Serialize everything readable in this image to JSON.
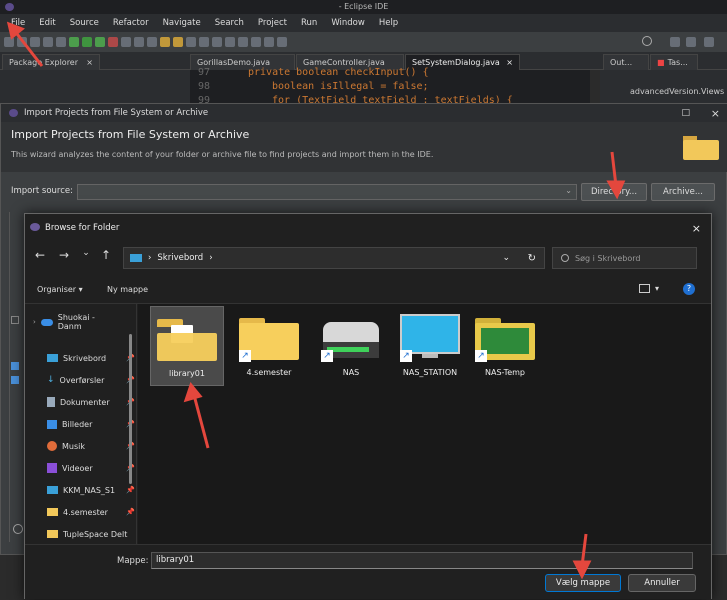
{
  "window": {
    "title": "- Eclipse IDE"
  },
  "menu": [
    "File",
    "Edit",
    "Source",
    "Refactor",
    "Navigate",
    "Search",
    "Project",
    "Run",
    "Window",
    "Help"
  ],
  "tabs": {
    "package_explorer": "Package Explorer",
    "editor_tabs": [
      "GorillasDemo.java",
      "GameController.java",
      "SetSystemDialog.java"
    ],
    "outline": "Out...",
    "tasks": "Tas..."
  },
  "code": {
    "lines": [
      {
        "n": "97",
        "t": "private boolean checkInput() {"
      },
      {
        "n": "98",
        "t": "boolean isIllegal = false;"
      },
      {
        "n": "99",
        "t": "for (TextField textField : textFields) {"
      }
    ],
    "right_panel_text": "advancedVersion.Views"
  },
  "import_dialog": {
    "window_title": "Import Projects from File System or Archive",
    "heading": "Import Projects from File System or Archive",
    "description": "This wizard analyzes the content of your folder or archive file to find projects and import them in the IDE.",
    "source_label": "Import source:",
    "directory_button": "Directory...",
    "archive_button": "Archive..."
  },
  "browse_dialog": {
    "title": "Browse for Folder",
    "address": "Skrivebord",
    "search_placeholder": "Søg i Skrivebord",
    "organize": "Organiser",
    "new_folder": "Ny mappe",
    "sidebar": [
      {
        "label": "Shuokai - Danm",
        "icon": "cloud-icon"
      },
      {
        "label": "Skrivebord",
        "icon": "desktop-icon"
      },
      {
        "label": "Overførsler",
        "icon": "download-icon"
      },
      {
        "label": "Dokumenter",
        "icon": "document-icon"
      },
      {
        "label": "Billeder",
        "icon": "picture-icon"
      },
      {
        "label": "Musik",
        "icon": "music-icon"
      },
      {
        "label": "Videoer",
        "icon": "video-icon"
      },
      {
        "label": "KKM_NAS_S1",
        "icon": "drive-icon"
      },
      {
        "label": "4.semester",
        "icon": "folder-icon"
      },
      {
        "label": "TupleSpace Delt",
        "icon": "folder-icon"
      }
    ],
    "items": [
      {
        "label": "library01",
        "kind": "folder",
        "selected": true
      },
      {
        "label": "4.semester",
        "kind": "folder-shortcut"
      },
      {
        "label": "NAS",
        "kind": "drive-shortcut"
      },
      {
        "label": "NAS_STATION",
        "kind": "monitor-shortcut"
      },
      {
        "label": "NAS-Temp",
        "kind": "folder-shortcut"
      }
    ],
    "folder_label": "Mappe:",
    "folder_value": "library01",
    "ok_button": "Vælg mappe",
    "cancel_button": "Annuller"
  },
  "colors": {
    "accent": "#0078d4",
    "annotation": "#e4473d",
    "folder": "#f7cf5c"
  }
}
